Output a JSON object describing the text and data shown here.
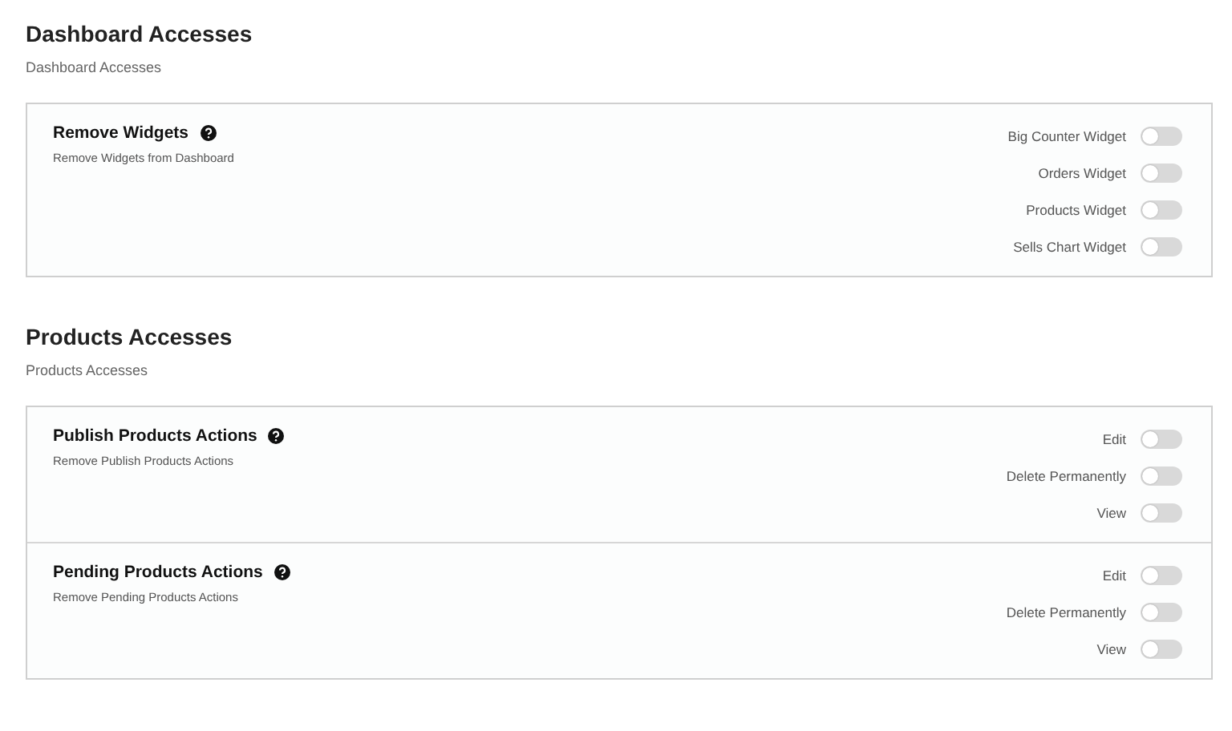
{
  "sections": [
    {
      "title": "Dashboard Accesses",
      "subtitle": "Dashboard Accesses",
      "groups": [
        {
          "title": "Remove Widgets",
          "description": "Remove Widgets from Dashboard",
          "options": [
            {
              "label": "Big Counter Widget",
              "on": false
            },
            {
              "label": "Orders Widget",
              "on": false
            },
            {
              "label": "Products Widget",
              "on": false
            },
            {
              "label": "Sells Chart Widget",
              "on": false
            }
          ]
        }
      ]
    },
    {
      "title": "Products Accesses",
      "subtitle": "Products Accesses",
      "groups": [
        {
          "title": "Publish Products Actions",
          "description": "Remove Publish Products Actions",
          "options": [
            {
              "label": "Edit",
              "on": false
            },
            {
              "label": "Delete Permanently",
              "on": false
            },
            {
              "label": "View",
              "on": false
            }
          ]
        },
        {
          "title": "Pending Products Actions",
          "description": "Remove Pending Products Actions",
          "options": [
            {
              "label": "Edit",
              "on": false
            },
            {
              "label": "Delete Permanently",
              "on": false
            },
            {
              "label": "View",
              "on": false
            }
          ]
        }
      ]
    }
  ]
}
